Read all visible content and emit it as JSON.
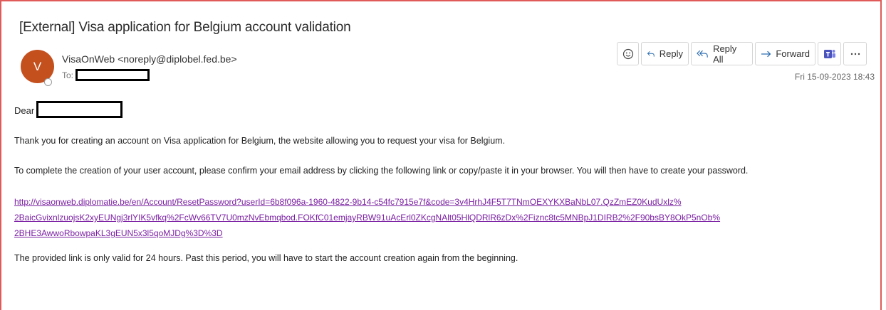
{
  "email": {
    "subject": "[External] Visa application for Belgium account validation",
    "avatar_initial": "V",
    "sender": "VisaOnWeb <noreply@diplobel.fed.be>",
    "to_label": "To:",
    "date": "Fri 15-09-2023 18:43",
    "greeting": "Dear",
    "body": {
      "p1": "Thank you for creating an account on Visa application for Belgium, the website allowing you to request your visa for Belgium.",
      "p2": "To complete the creation of your user account, please confirm your email address by clicking the following link or copy/paste it in your browser. You will then have to create your password.",
      "link_lines": [
        "http://visaonweb.diplomatie.be/en/Account/ResetPassword?userId=6b8f096a-1960-4822-9b14-c54fc7915e7f&code=3v4HrhJ4F5T7TNmOEXYKXBaNbL07.QzZmEZ0KudUxlz%",
        "2BaicGvixnlzuojsK2xyEUNgj3rlYIK5vfkq%2FcWv66TV7U0mzNvEbmqbod.FOKfC01emjayRBW91uAcErl0ZKcgNAlt05HlQDRlR6zDx%2Fiznc8tc5MNBpJ1DIRB2%2F90bsBY8OkP5nOb%",
        "2BHE3AwwoRbowpaKL3gEUN5x3l5qoMJDg%3D%3D"
      ],
      "p3": "The provided link is only valid for 24 hours. Past this period, you will have to start the account creation again from the beginning."
    }
  },
  "toolbar": {
    "reply": "Reply",
    "reply_all": "Reply All",
    "forward": "Forward"
  },
  "icons": {
    "emoji": "emoji-icon",
    "reply": "reply-icon",
    "reply_all": "reply-all-icon",
    "forward": "forward-icon",
    "teams": "teams-icon",
    "more": "more-icon"
  },
  "colors": {
    "frame_border": "#e05a5a",
    "avatar": "#c4501e",
    "link": "#7a1fa2",
    "teams": "#4b53bc",
    "accent": "#2b6cb0"
  }
}
